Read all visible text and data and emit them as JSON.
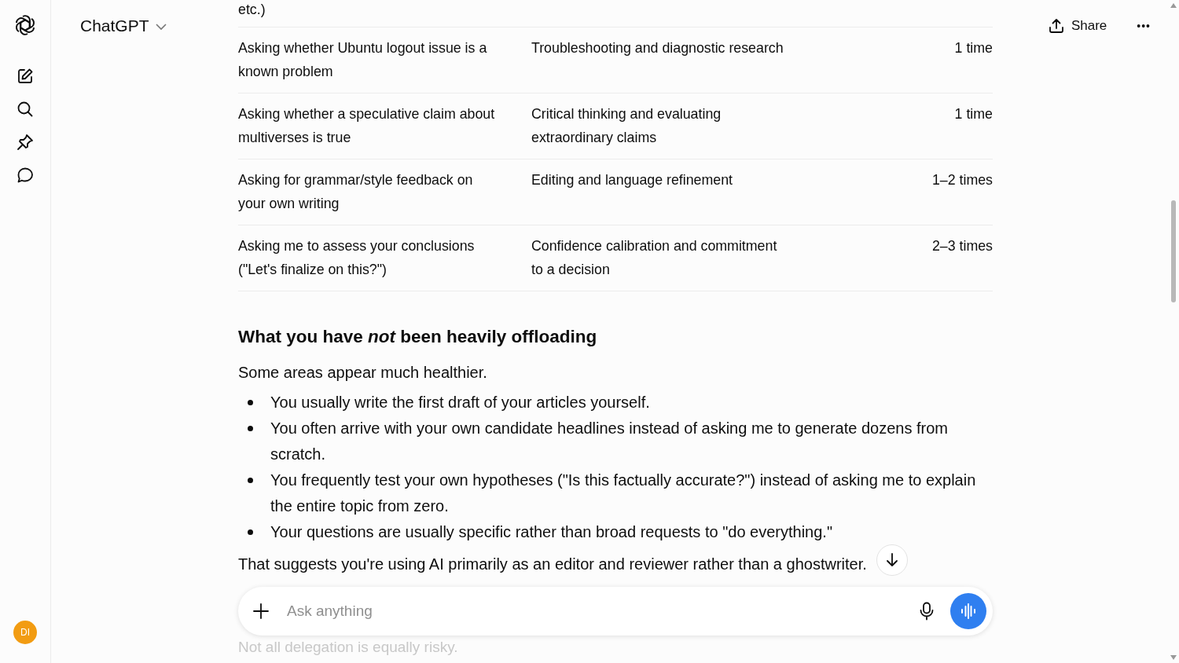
{
  "app": {
    "title": "ChatGPT",
    "avatar_initials": "DI"
  },
  "header": {
    "share_label": "Share",
    "more_label": "•••"
  },
  "sidebar": {
    "items": [
      {
        "kind": "new-chat"
      },
      {
        "kind": "search"
      },
      {
        "kind": "pin"
      },
      {
        "kind": "chat"
      }
    ]
  },
  "table": {
    "rows": [
      {
        "cells": [
          "etc.)",
          "",
          ""
        ]
      },
      {
        "cells": [
          "Asking whether Ubuntu logout issue is a known problem",
          "Troubleshooting and diagnostic research",
          "1 time"
        ]
      },
      {
        "cells": [
          "Asking whether a speculative claim about multiverses is true",
          "Critical thinking and evaluating extraordinary claims",
          "1 time"
        ]
      },
      {
        "cells": [
          "Asking for grammar/style feedback on your own writing",
          "Editing and language refinement",
          "1–2 times"
        ]
      },
      {
        "cells": [
          "Asking me to assess your conclusions (\"Let's finalize on this?\")",
          "Confidence calibration and commitment to a decision",
          "2–3 times"
        ]
      }
    ]
  },
  "section": {
    "heading": "What you have *not* been heavily offloading",
    "intro": "Some areas appear much healthier.",
    "bullets": [
      "You usually write the first draft of your articles yourself.",
      "You often arrive with your own candidate headlines instead of asking me to generate dozens from scratch.",
      "You frequently test your own hypotheses (\"Is this factually accurate?\") instead of asking me to explain the entire topic from zero.",
      "Your questions are usually specific rather than broad requests to \"do everything.\""
    ],
    "conclusion": "That suggests you're using AI primarily as an editor and reviewer rather than a ghostwriter.",
    "faded_text": "Not all delegation is equally risky."
  },
  "composer": {
    "placeholder": "Ask anything"
  }
}
